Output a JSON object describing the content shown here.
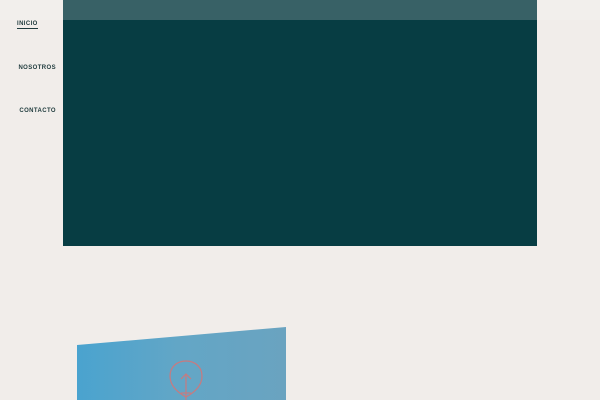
{
  "nav": {
    "items": [
      {
        "label": "INICIO",
        "active": true
      },
      {
        "label": "NOSOTROS",
        "active": false
      },
      {
        "label": "CONTACTO",
        "active": false
      }
    ]
  },
  "colors": {
    "background": "#f1edea",
    "hero": "#073d43",
    "hero_strip": "#1d4c51",
    "nav_text": "#1e3a3c",
    "feature_blue": "#5ea6cb",
    "bulb_outline": "#c87a7f"
  },
  "feature": {
    "icon": "lightbulb-icon"
  }
}
